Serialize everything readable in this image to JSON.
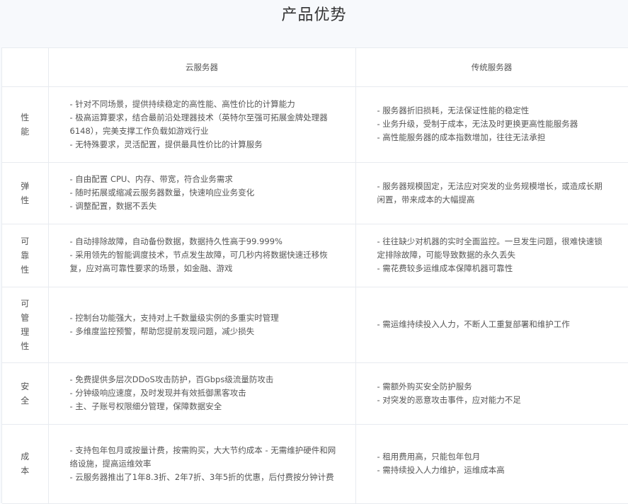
{
  "title": "产品优势",
  "headers": {
    "cloud": "云服务器",
    "traditional": "传统服务器"
  },
  "rows": [
    {
      "label": "性能",
      "cloud": [
        "- 针对不同场景，提供持续稳定的高性能、高性价比的计算能力",
        "- 极高运算要求，结合最前沿处理器技术（英特尔至强可拓展金牌处理器6148），完美支撑工作负载如游戏行业",
        "- 无特殊要求，灵活配置，提供最具性价比的计算服务"
      ],
      "traditional": [
        "- 服务器折旧损耗，无法保证性能的稳定性",
        "- 业务升级，受制于成本，无法及时更换更高性能服务器",
        "- 高性能服务器的成本指数增加，往往无法承担"
      ]
    },
    {
      "label": "弹性",
      "cloud": [
        "- 自由配置 CPU、内存、带宽，符合业务需求",
        "- 随时拓展或缩减云服务器数量，快速响应业务变化",
        "- 调整配置，数据不丢失"
      ],
      "traditional": [
        "- 服务器规模固定，无法应对突发的业务规模增长，或造成长期闲置，带来成本的大幅提高"
      ]
    },
    {
      "label": "可靠性",
      "cloud": [
        "- 自动排除故障，自动备份数据，数据持久性高于99.999%",
        "- 采用领先的智能调度技术，节点发生故障，可几秒内将数据快速迁移恢复，应对高可靠性要求的场景，如金融、游戏"
      ],
      "traditional": [
        "- 往往缺少对机器的实时全面监控。一旦发生问题，很难快速锁定排除故障，可能导致数据的永久丢失",
        "- 需花费较多运维成本保障机器可靠性"
      ]
    },
    {
      "label": "可管理性",
      "cloud": [
        "- 控制台功能强大，支持对上千数量级实例的多重实时管理",
        "- 多维度监控预警，帮助您提前发现问题，减少损失"
      ],
      "traditional": [
        "- 需运维持续投入人力，不断人工重复部署和维护工作"
      ]
    },
    {
      "label": "安全",
      "cloud": [
        "- 免费提供多层次DDoS攻击防护，百Gbps级流量防攻击",
        "- 分钟级响应速度，及时发现并有效抵御黑客攻击",
        "- 主、子账号权限细分管理，保障数据安全"
      ],
      "traditional": [
        "- 需额外购买安全防护服务",
        "- 对突发的恶意攻击事件，应对能力不足"
      ]
    },
    {
      "label": "成本",
      "cloud": [
        "- 支持包年包月或按量计费，按需购买，大大节约成本 - 无需维护硬件和网络设施，提高运维效率",
        "- 云服务器推出了1年8.3折、2年7折、3年5折的优惠，后付费按分钟计费"
      ],
      "traditional": [
        "- 租用费用高，只能包年包月",
        "- 需持续投入人力维护，运维成本高"
      ]
    }
  ]
}
